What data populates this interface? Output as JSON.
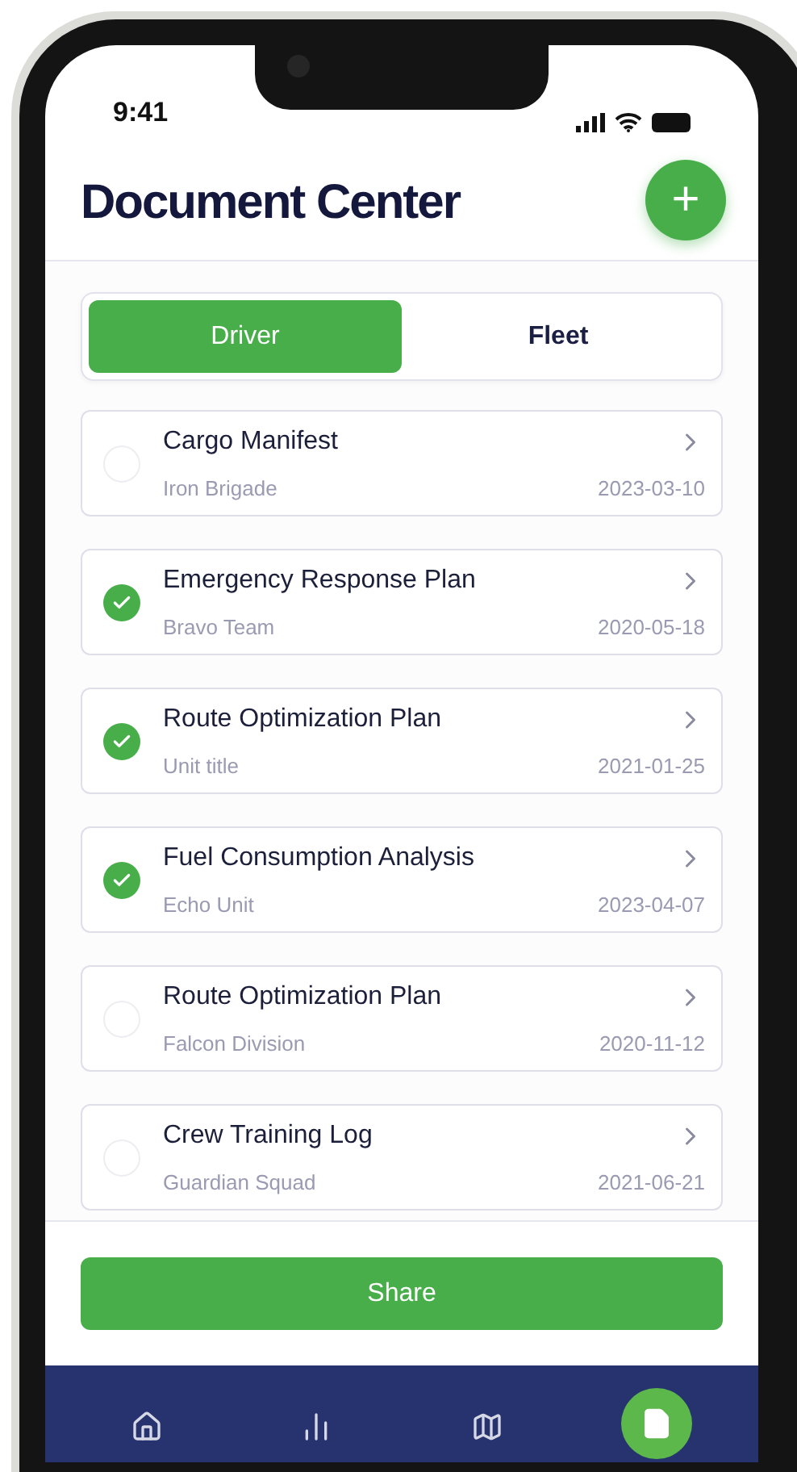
{
  "status_bar": {
    "time": "9:41"
  },
  "header": {
    "title": "Document Center",
    "add_button": "+"
  },
  "tabs": [
    {
      "label": "Driver",
      "selected": true
    },
    {
      "label": "Fleet",
      "selected": false
    }
  ],
  "documents": [
    {
      "title": "Cargo Manifest",
      "subtitle": "Iron Brigade",
      "date": "2023-03-10",
      "checked": false
    },
    {
      "title": "Emergency Response Plan",
      "subtitle": "Bravo Team",
      "date": "2020-05-18",
      "checked": true
    },
    {
      "title": "Route Optimization Plan",
      "subtitle": "Unit title",
      "date": "2021-01-25",
      "checked": true
    },
    {
      "title": "Fuel Consumption Analysis",
      "subtitle": "Echo Unit",
      "date": "2023-04-07",
      "checked": true
    },
    {
      "title": "Route Optimization Plan",
      "subtitle": "Falcon Division",
      "date": "2020-11-12",
      "checked": false
    },
    {
      "title": "Crew Training Log",
      "subtitle": "Guardian Squad",
      "date": "2021-06-21",
      "checked": false
    }
  ],
  "share_button": "Share",
  "nav": [
    {
      "selected": false
    },
    {
      "selected": false
    },
    {
      "selected": false
    },
    {
      "selected": true
    }
  ]
}
